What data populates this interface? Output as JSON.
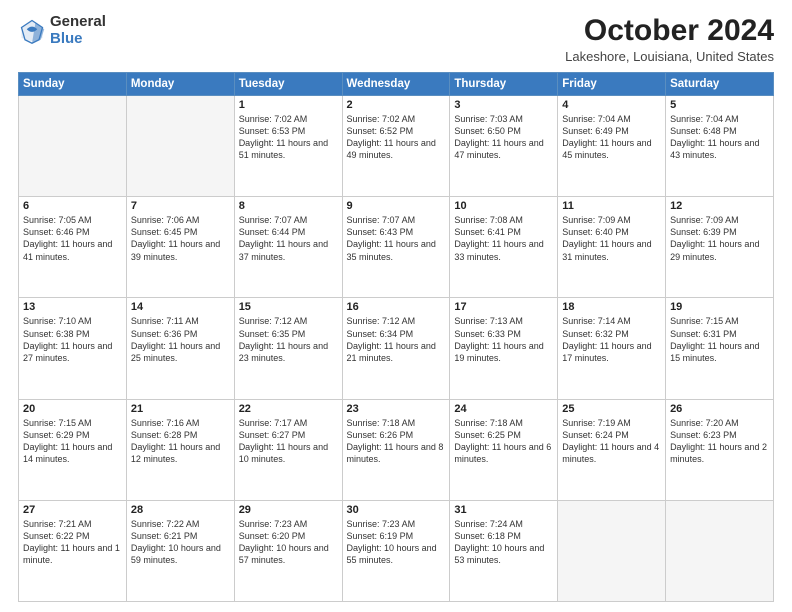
{
  "header": {
    "logo_general": "General",
    "logo_blue": "Blue",
    "month_title": "October 2024",
    "location": "Lakeshore, Louisiana, United States"
  },
  "weekdays": [
    "Sunday",
    "Monday",
    "Tuesday",
    "Wednesday",
    "Thursday",
    "Friday",
    "Saturday"
  ],
  "weeks": [
    [
      {
        "day": "",
        "info": ""
      },
      {
        "day": "",
        "info": ""
      },
      {
        "day": "1",
        "info": "Sunrise: 7:02 AM\nSunset: 6:53 PM\nDaylight: 11 hours\nand 51 minutes."
      },
      {
        "day": "2",
        "info": "Sunrise: 7:02 AM\nSunset: 6:52 PM\nDaylight: 11 hours\nand 49 minutes."
      },
      {
        "day": "3",
        "info": "Sunrise: 7:03 AM\nSunset: 6:50 PM\nDaylight: 11 hours\nand 47 minutes."
      },
      {
        "day": "4",
        "info": "Sunrise: 7:04 AM\nSunset: 6:49 PM\nDaylight: 11 hours\nand 45 minutes."
      },
      {
        "day": "5",
        "info": "Sunrise: 7:04 AM\nSunset: 6:48 PM\nDaylight: 11 hours\nand 43 minutes."
      }
    ],
    [
      {
        "day": "6",
        "info": "Sunrise: 7:05 AM\nSunset: 6:46 PM\nDaylight: 11 hours\nand 41 minutes."
      },
      {
        "day": "7",
        "info": "Sunrise: 7:06 AM\nSunset: 6:45 PM\nDaylight: 11 hours\nand 39 minutes."
      },
      {
        "day": "8",
        "info": "Sunrise: 7:07 AM\nSunset: 6:44 PM\nDaylight: 11 hours\nand 37 minutes."
      },
      {
        "day": "9",
        "info": "Sunrise: 7:07 AM\nSunset: 6:43 PM\nDaylight: 11 hours\nand 35 minutes."
      },
      {
        "day": "10",
        "info": "Sunrise: 7:08 AM\nSunset: 6:41 PM\nDaylight: 11 hours\nand 33 minutes."
      },
      {
        "day": "11",
        "info": "Sunrise: 7:09 AM\nSunset: 6:40 PM\nDaylight: 11 hours\nand 31 minutes."
      },
      {
        "day": "12",
        "info": "Sunrise: 7:09 AM\nSunset: 6:39 PM\nDaylight: 11 hours\nand 29 minutes."
      }
    ],
    [
      {
        "day": "13",
        "info": "Sunrise: 7:10 AM\nSunset: 6:38 PM\nDaylight: 11 hours\nand 27 minutes."
      },
      {
        "day": "14",
        "info": "Sunrise: 7:11 AM\nSunset: 6:36 PM\nDaylight: 11 hours\nand 25 minutes."
      },
      {
        "day": "15",
        "info": "Sunrise: 7:12 AM\nSunset: 6:35 PM\nDaylight: 11 hours\nand 23 minutes."
      },
      {
        "day": "16",
        "info": "Sunrise: 7:12 AM\nSunset: 6:34 PM\nDaylight: 11 hours\nand 21 minutes."
      },
      {
        "day": "17",
        "info": "Sunrise: 7:13 AM\nSunset: 6:33 PM\nDaylight: 11 hours\nand 19 minutes."
      },
      {
        "day": "18",
        "info": "Sunrise: 7:14 AM\nSunset: 6:32 PM\nDaylight: 11 hours\nand 17 minutes."
      },
      {
        "day": "19",
        "info": "Sunrise: 7:15 AM\nSunset: 6:31 PM\nDaylight: 11 hours\nand 15 minutes."
      }
    ],
    [
      {
        "day": "20",
        "info": "Sunrise: 7:15 AM\nSunset: 6:29 PM\nDaylight: 11 hours\nand 14 minutes."
      },
      {
        "day": "21",
        "info": "Sunrise: 7:16 AM\nSunset: 6:28 PM\nDaylight: 11 hours\nand 12 minutes."
      },
      {
        "day": "22",
        "info": "Sunrise: 7:17 AM\nSunset: 6:27 PM\nDaylight: 11 hours\nand 10 minutes."
      },
      {
        "day": "23",
        "info": "Sunrise: 7:18 AM\nSunset: 6:26 PM\nDaylight: 11 hours\nand 8 minutes."
      },
      {
        "day": "24",
        "info": "Sunrise: 7:18 AM\nSunset: 6:25 PM\nDaylight: 11 hours\nand 6 minutes."
      },
      {
        "day": "25",
        "info": "Sunrise: 7:19 AM\nSunset: 6:24 PM\nDaylight: 11 hours\nand 4 minutes."
      },
      {
        "day": "26",
        "info": "Sunrise: 7:20 AM\nSunset: 6:23 PM\nDaylight: 11 hours\nand 2 minutes."
      }
    ],
    [
      {
        "day": "27",
        "info": "Sunrise: 7:21 AM\nSunset: 6:22 PM\nDaylight: 11 hours\nand 1 minute."
      },
      {
        "day": "28",
        "info": "Sunrise: 7:22 AM\nSunset: 6:21 PM\nDaylight: 10 hours\nand 59 minutes."
      },
      {
        "day": "29",
        "info": "Sunrise: 7:23 AM\nSunset: 6:20 PM\nDaylight: 10 hours\nand 57 minutes."
      },
      {
        "day": "30",
        "info": "Sunrise: 7:23 AM\nSunset: 6:19 PM\nDaylight: 10 hours\nand 55 minutes."
      },
      {
        "day": "31",
        "info": "Sunrise: 7:24 AM\nSunset: 6:18 PM\nDaylight: 10 hours\nand 53 minutes."
      },
      {
        "day": "",
        "info": ""
      },
      {
        "day": "",
        "info": ""
      }
    ]
  ]
}
